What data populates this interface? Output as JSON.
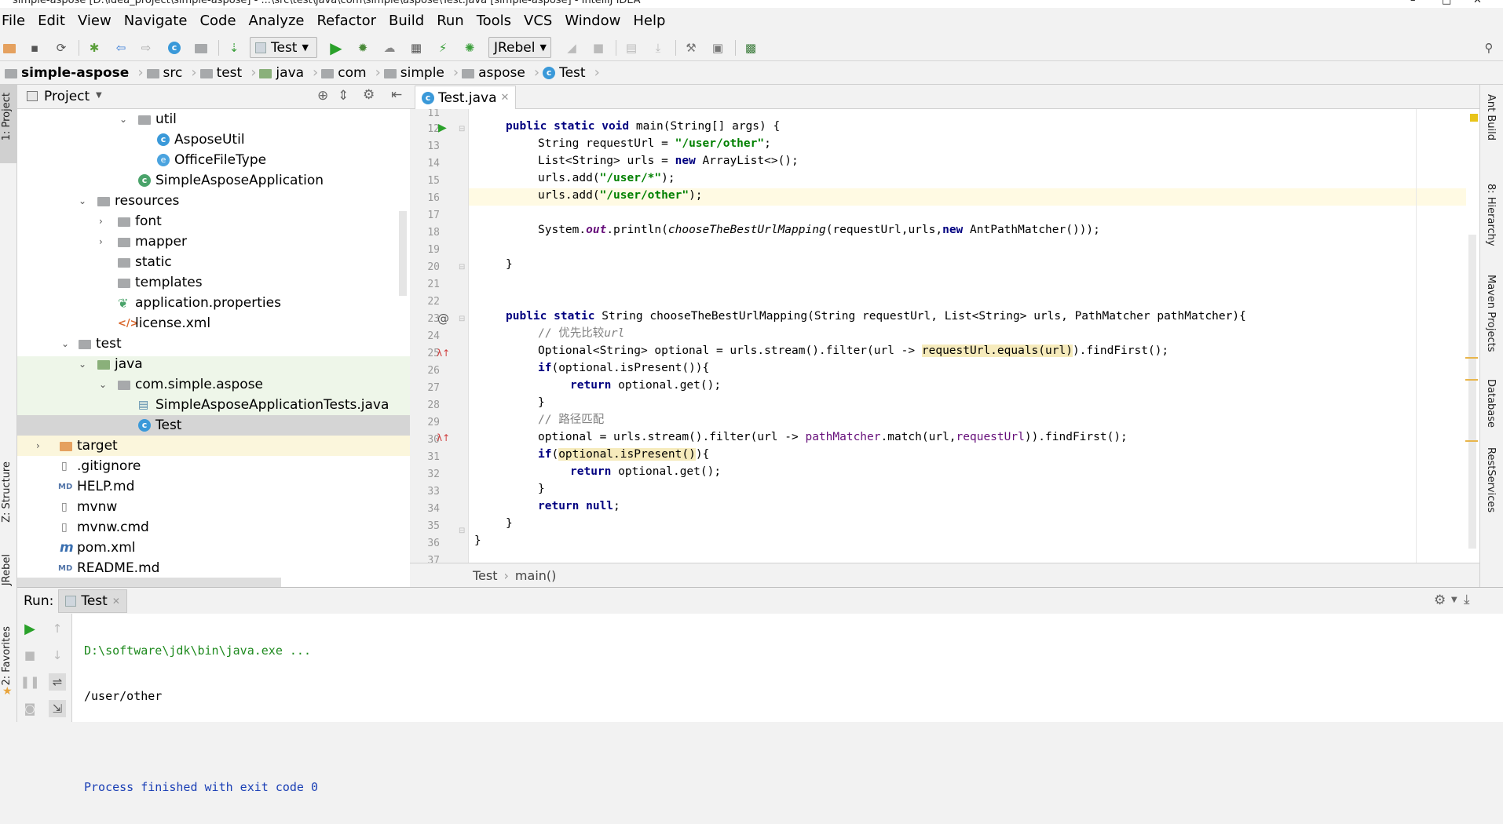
{
  "window": {
    "title": "simple-aspose [D:\\idea_project\\simple-aspose] - ...\\src\\test\\java\\com\\simple\\aspose\\Test.java [simple-aspose] - IntelliJ IDEA",
    "controls": [
      "–",
      "□",
      "✕"
    ]
  },
  "menu": [
    "File",
    "Edit",
    "View",
    "Navigate",
    "Code",
    "Analyze",
    "Refactor",
    "Build",
    "Run",
    "Tools",
    "VCS",
    "Window",
    "Help"
  ],
  "toolbar": {
    "run_config": "Test",
    "jrebel_config": "JRebel"
  },
  "breadcrumb": [
    "simple-aspose",
    "src",
    "test",
    "java",
    "com",
    "simple",
    "aspose",
    "Test"
  ],
  "left_strip": {
    "project": "1: Project",
    "structure": "Z: Structure",
    "jrebel": "JRebel",
    "favorites": "2: Favorites"
  },
  "right_strip": [
    "Ant Build",
    "8: Hierarchy",
    "Maven Projects",
    "Database",
    "RestServices"
  ],
  "project_panel": {
    "title": "Project",
    "tree": [
      {
        "label": "util",
        "icon": "folder",
        "expanded": true
      },
      {
        "label": "AsposeUtil",
        "icon": "class-c-icon"
      },
      {
        "label": "OfficeFileType",
        "icon": "enum-e-icon"
      },
      {
        "label": "SimpleAsposeApplication",
        "icon": "spring-class-icon"
      },
      {
        "label": "resources",
        "icon": "folder",
        "expanded": true
      },
      {
        "label": "font",
        "icon": "folder",
        "expanded": false
      },
      {
        "label": "mapper",
        "icon": "folder",
        "expanded": false
      },
      {
        "label": "static",
        "icon": "folder"
      },
      {
        "label": "templates",
        "icon": "folder"
      },
      {
        "label": "application.properties",
        "icon": "spring-properties-icon"
      },
      {
        "label": "license.xml",
        "icon": "xml-file-icon"
      },
      {
        "label": "test",
        "icon": "folder",
        "expanded": true
      },
      {
        "label": "java",
        "icon": "folder",
        "expanded": true
      },
      {
        "label": "com.simple.aspose",
        "icon": "package-folder",
        "expanded": true
      },
      {
        "label": "SimpleAsposeApplicationTests.java",
        "icon": "java-file-icon"
      },
      {
        "label": "Test",
        "icon": "class-c-icon",
        "selected": true
      },
      {
        "label": "target",
        "icon": "folder",
        "expanded": false
      },
      {
        "label": ".gitignore",
        "icon": "text-file-icon"
      },
      {
        "label": "HELP.md",
        "icon": "md-file-icon"
      },
      {
        "label": "mvnw",
        "icon": "text-file-icon"
      },
      {
        "label": "mvnw.cmd",
        "icon": "text-file-icon"
      },
      {
        "label": "pom.xml",
        "icon": "maven-icon"
      },
      {
        "label": "README.md",
        "icon": "md-file-icon"
      }
    ]
  },
  "editor": {
    "tab": "Test.java",
    "line_numbers": [
      "11",
      "12",
      "13",
      "14",
      "15",
      "16",
      "17",
      "18",
      "19",
      "20",
      "21",
      "22",
      "23",
      "24",
      "25",
      "26",
      "27",
      "28",
      "29",
      "30",
      "31",
      "32",
      "33",
      "34",
      "35",
      "36",
      "37"
    ],
    "footer": [
      "Test",
      "main()"
    ],
    "code": {
      "l12a": "public static void",
      "l12b": " main(String[] args) {",
      "l13a": "String requestUrl = ",
      "l13b": "\"/user/other\"",
      "l13c": ";",
      "l14a": "List<String> urls = ",
      "l14b": "new",
      "l14c": " ArrayList<>();",
      "l15a": "urls.add(",
      "l15b": "\"/user/*\"",
      "l15c": ");",
      "l16a": "urls.add(",
      "l16b": "\"/user/other\"",
      "l16c": ");",
      "l18a": "System.",
      "l18b": "out",
      "l18c": ".println(",
      "l18d": "chooseTheBestUrlMapping",
      "l18e": "(requestUrl,urls,",
      "l18f": "new",
      "l18g": " AntPathMatcher()));",
      "l20": "}",
      "l23a": "public static",
      "l23b": " String chooseTheBestUrlMapping(String requestUrl, List<String> urls, PathMatcher pathMatcher){",
      "l24a": "// 优先比较",
      "l24b": "url",
      "l25a": "Optional<String> optional = urls.stream().filter(url -> ",
      "l25b": "requestUrl.equals(url)",
      "l25c": ").findFirst();",
      "l26a": "if",
      "l26b": "(optional.isPresent()){",
      "l27a": "return",
      "l27b": " optional.get();",
      "l28": "}",
      "l29": "// 路径匹配",
      "l30a": "optional = urls.stream().filter(url -> ",
      "l30b": "pathMatcher",
      "l30c": ".match(url,",
      "l30d": "requestUrl",
      "l30e": ")).findFirst();",
      "l31a": "if",
      "l31b": "(",
      "l31c": "optional.isPresent()",
      "l31d": "){",
      "l32a": "return",
      "l32b": " optional.get();",
      "l33": "}",
      "l34a": "return null",
      "l34b": ";",
      "l35": "}",
      "l36": "}"
    }
  },
  "run_panel": {
    "label": "Run:",
    "tab": "Test",
    "console": [
      "D:\\software\\jdk\\bin\\java.exe ...",
      "/user/other",
      "",
      "Process finished with exit code 0"
    ]
  }
}
